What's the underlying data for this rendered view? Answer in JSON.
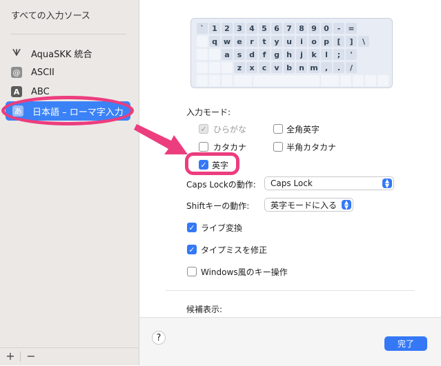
{
  "sidebar": {
    "title": "すべての入力ソース",
    "items": [
      {
        "label": "AquaSKK 統合",
        "icon": "ᗐ"
      },
      {
        "label": "ASCII",
        "icon": "@"
      },
      {
        "label": "ABC",
        "icon": "A"
      },
      {
        "label": "日本語 – ローマ字入力",
        "icon": "あ"
      }
    ],
    "add_label": "+",
    "remove_label": "−"
  },
  "keyboard": {
    "row1": [
      "`",
      "1",
      "2",
      "3",
      "4",
      "5",
      "6",
      "7",
      "8",
      "9",
      "0",
      "-",
      "="
    ],
    "row2": [
      "q",
      "w",
      "e",
      "r",
      "t",
      "y",
      "u",
      "i",
      "o",
      "p",
      "[",
      "]",
      "\\"
    ],
    "row3": [
      "a",
      "s",
      "d",
      "f",
      "g",
      "h",
      "j",
      "k",
      "l",
      ";",
      "'"
    ],
    "row4": [
      "z",
      "x",
      "c",
      "v",
      "b",
      "n",
      "m",
      ",",
      ".",
      "/"
    ]
  },
  "input_mode": {
    "title": "入力モード:",
    "options": [
      {
        "label": "ひらがな",
        "checked": true,
        "disabled": true
      },
      {
        "label": "全角英字",
        "checked": false,
        "disabled": false
      },
      {
        "label": "カタカナ",
        "checked": false,
        "disabled": false
      },
      {
        "label": "半角カタカナ",
        "checked": false,
        "disabled": false
      },
      {
        "label": "英字",
        "checked": true,
        "disabled": false
      }
    ]
  },
  "capslock": {
    "label": "Caps Lockの動作:",
    "value": "Caps Lock"
  },
  "shift": {
    "label": "Shiftキーの動作:",
    "value": "英字モードに入る"
  },
  "checks": [
    {
      "label": "ライブ変換",
      "checked": true
    },
    {
      "label": "タイプミスを修正",
      "checked": true
    },
    {
      "label": "Windows風のキー操作",
      "checked": false
    }
  ],
  "candidates": {
    "title": "候補表示:"
  },
  "footer": {
    "help_label": "?",
    "done_label": "完了"
  },
  "glyphs": {
    "check": "✓",
    "up": "▲",
    "down": "▼",
    "arrow": "➜"
  },
  "colors": {
    "accent": "#3478f6",
    "highlight": "#ec3d7e",
    "selection": "#3b82f6"
  }
}
